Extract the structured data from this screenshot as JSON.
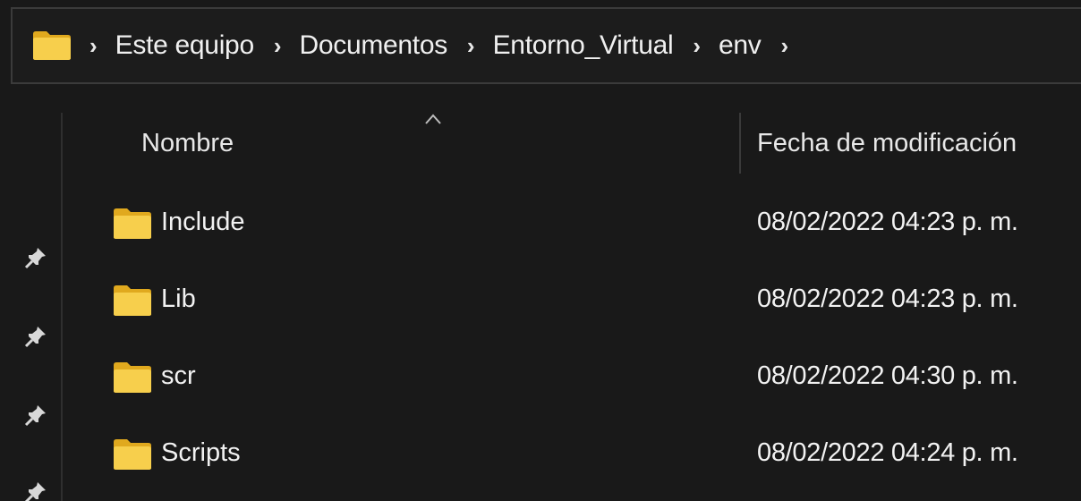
{
  "address_bar": {
    "root_icon": "folder-icon",
    "breadcrumbs": [
      "Este equipo",
      "Documentos",
      "Entorno_Virtual",
      "env"
    ],
    "separator_glyph": "›"
  },
  "columns": {
    "name": "Nombre",
    "date": "Fecha de modificación",
    "sort_icon": "sort-ascending-icon"
  },
  "nav": {
    "pin_icon": "pin-icon"
  },
  "files": [
    {
      "name": "Include",
      "modified": "08/02/2022 04:23 p. m.",
      "icon": "folder-icon"
    },
    {
      "name": "Lib",
      "modified": "08/02/2022 04:23 p. m.",
      "icon": "folder-icon"
    },
    {
      "name": "scr",
      "modified": "08/02/2022 04:30 p. m.",
      "icon": "folder-icon"
    },
    {
      "name": "Scripts",
      "modified": "08/02/2022 04:24 p. m.",
      "icon": "folder-icon"
    }
  ],
  "colors": {
    "background": "#191919",
    "folder": "#f5c842",
    "folder_tab": "#e0a91e",
    "text": "#f2f2f2"
  }
}
